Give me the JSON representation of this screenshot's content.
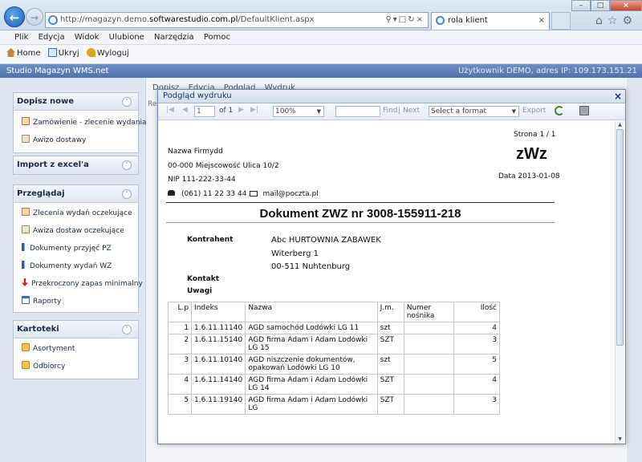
{
  "browser": {
    "url_prefix": "http://magazyn.demo.",
    "url_host": "softwarestudio.com.pl",
    "url_path": "/DefaultKlient.aspx",
    "tab_title": "rola klient"
  },
  "menu": [
    "Plik",
    "Edycja",
    "Widok",
    "Ulubione",
    "Narzędzia",
    "Pomoc"
  ],
  "toolbar": {
    "home": "Home",
    "hide": "Ukryj",
    "logout": "Wyloguj"
  },
  "app": {
    "title": "Studio Magazyn WMS.net",
    "user_info": "Użytkownik DEMO, adres IP: 109.173.151.21"
  },
  "center": {
    "tools": [
      "Dopisz",
      "Edycja",
      "Podgląd",
      "Wydruk"
    ],
    "left_edge": "Re"
  },
  "sidebar": {
    "dopisz": {
      "title": "Dopisz nowe",
      "items": [
        "Zamówienie - zlecenie wydania",
        "Awizo dostawy"
      ]
    },
    "import": {
      "title": "Import z excel'a"
    },
    "przegladaj": {
      "title": "Przeglądaj",
      "items": [
        "Zlecenia wydań oczekujące",
        "Awiza dostaw oczekujące",
        "Dokumenty przyjęć PZ",
        "Dokumenty wydań WZ",
        "Przekroczony zapas minimalny",
        "Raporty"
      ]
    },
    "kartoteki": {
      "title": "Kartoteki",
      "items": [
        "Asortyment",
        "Odbiorcy"
      ]
    }
  },
  "modal": {
    "title": "Podgląd wydruku",
    "page": "1",
    "of": "of 1",
    "zoom": "100%",
    "find": "Find",
    "sep": "|",
    "next": "Next",
    "format": "Select a format",
    "export": "Export"
  },
  "report": {
    "page_label": "Strona 1 / 1",
    "firm_name": "Nazwa Firmydd",
    "firm_address": "00-000 Miejscowość Ulica 10/2",
    "nip": "NIP 111-222-33-44",
    "phone": "(061) 11 22 33 44",
    "email": "mail@poczta.pl",
    "doc_code": "zWz",
    "date": "Data 2013-01-08",
    "doc_title": "Dokument ZWZ nr 3008-155911-218",
    "contractor_label": "Kontrahent",
    "contractor_name": "Abc HURTOWNIA ZABAWEK",
    "contractor_street": "Witerberg 1",
    "contractor_city": "00-511 Nuhtenburg",
    "contact_label": "Kontakt",
    "notes_label": "Uwagi",
    "columns": [
      "L.p",
      "Indeks",
      "Nazwa",
      "J.m.",
      "Numer nośnika",
      "Ilość"
    ],
    "rows": [
      [
        "1",
        "1.6.11.11140",
        "AGD samochód Lodówki LG 11",
        "szt",
        "",
        "4"
      ],
      [
        "2",
        "1.6.11.15140",
        "AGD firma Adam i Adam Lodówki LG 15",
        "SZT",
        "",
        "3"
      ],
      [
        "3",
        "1.6.11.10140",
        "AGD niszczenie dokumentów, opakowań Lodówki LG 10",
        "szt",
        "",
        "5"
      ],
      [
        "4",
        "1.6.11.14140",
        "AGD firma Adam i Adam Lodówki LG 14",
        "SZT",
        "",
        "4"
      ],
      [
        "5",
        "1.6.11.19140",
        "AGD firma Adam i Adam Lodówki LG",
        "SZT",
        "",
        "3"
      ]
    ]
  }
}
